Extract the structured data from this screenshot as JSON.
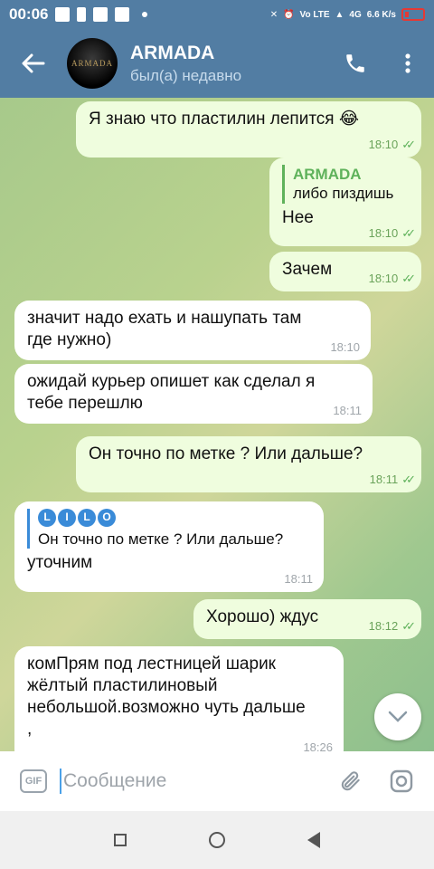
{
  "status_bar": {
    "time": "00:06",
    "net_speed": "6.6 K/s",
    "net_type": "4G",
    "volte": "Vo LTE"
  },
  "header": {
    "name": "ARMADA",
    "status": "был(а) недавно",
    "avatar_text": "ARMADA"
  },
  "messages": [
    {
      "dir": "out",
      "text": "Я знаю что пластилин лепится 😂",
      "time": "18:10"
    },
    {
      "dir": "out",
      "reply_name": "ARMADA",
      "reply_text": "либо пиздишь",
      "text": "Нее",
      "time": "18:10"
    },
    {
      "dir": "out",
      "text": "Зачем",
      "time": "18:10"
    },
    {
      "dir": "in",
      "text": "значит надо ехать и нашупать там где нужно)",
      "time": "18:10"
    },
    {
      "dir": "in",
      "text": "ожидай курьер опишет как сделал я тебе перешлю",
      "time": "18:11"
    },
    {
      "dir": "out",
      "text": "Он точно по метке ? Или дальше?",
      "time": "18:11"
    },
    {
      "dir": "in",
      "reply_name": "LILO",
      "reply_text": "Он точно по метке ? Или дальше?",
      "text": "уточним",
      "time": "18:11"
    },
    {
      "dir": "out",
      "text": "Хорошо) ждус",
      "time": "18:12"
    },
    {
      "dir": "in",
      "text": "комПрям под лестницей шарик жёлтый пластилиновый небольшой.возможно чуть дальше ,",
      "time": "18:26"
    }
  ],
  "input": {
    "placeholder": "Сообщение",
    "gif_label": "GIF"
  },
  "colors": {
    "header": "#527da3",
    "out_bubble": "#effdde",
    "in_bubble": "#ffffff",
    "accent": "#5fb25b"
  }
}
